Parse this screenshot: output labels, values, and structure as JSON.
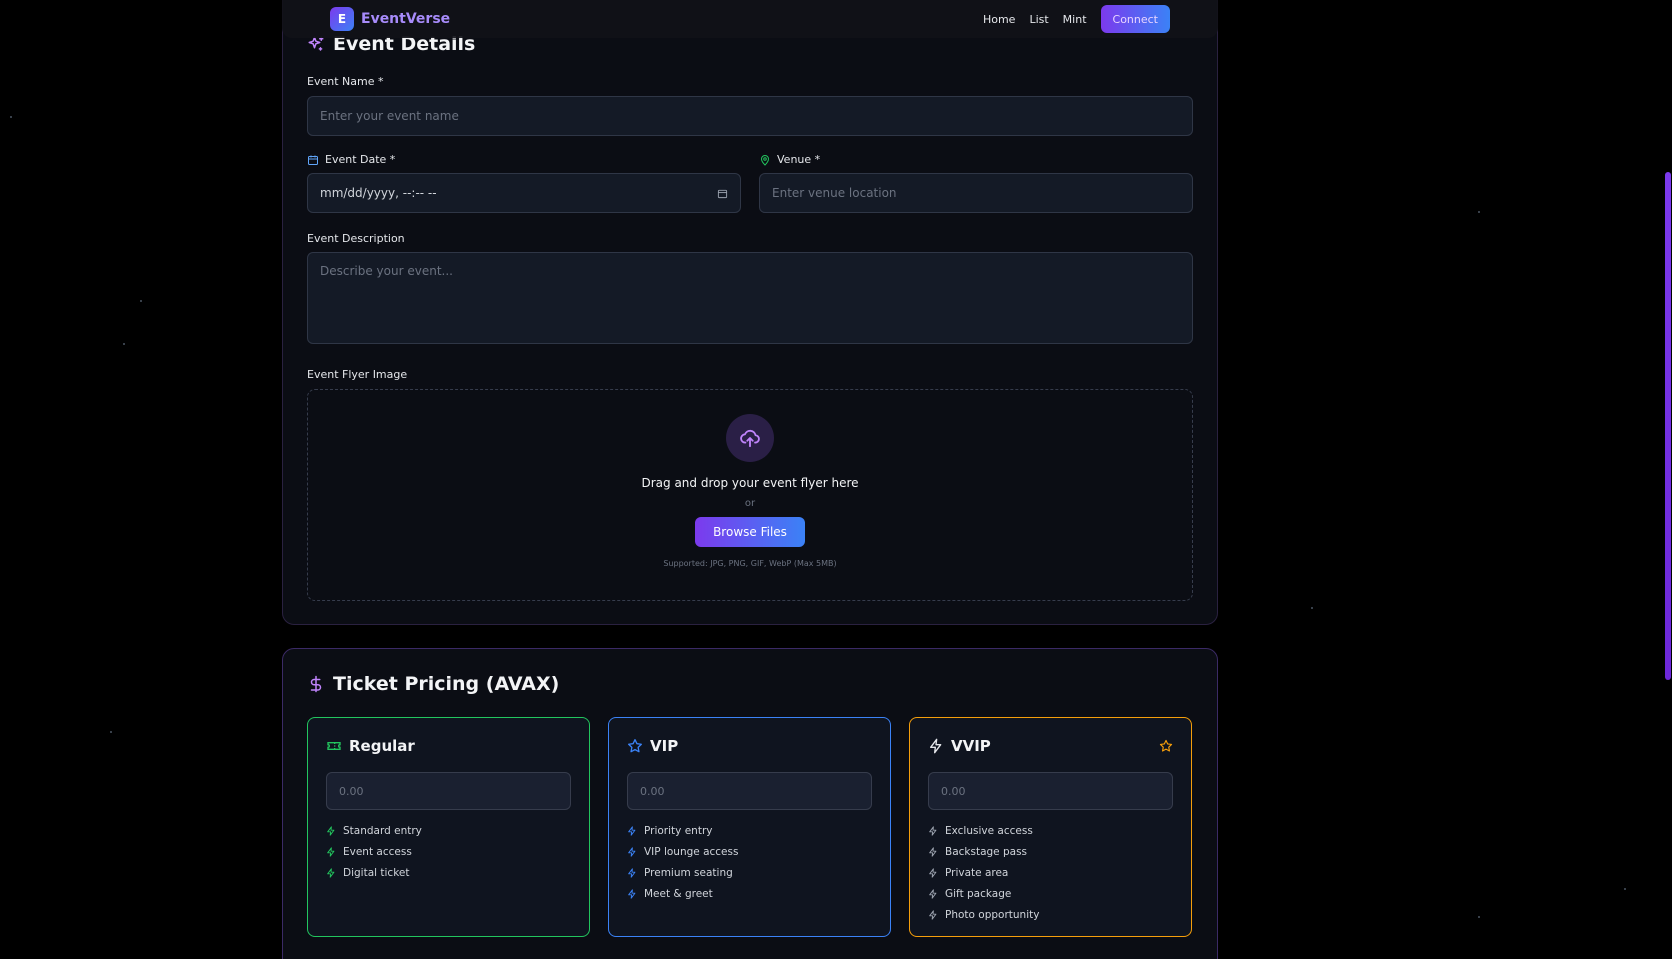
{
  "header": {
    "logo_letter": "E",
    "brand": "EventVerse",
    "nav": [
      "Home",
      "List",
      "Mint"
    ],
    "connect_label": "Connect"
  },
  "details": {
    "title": "Event Details",
    "event_name_label": "Event Name *",
    "event_name_placeholder": "Enter your event name",
    "event_date_label": "Event Date *",
    "event_date_value": "mm/dd/yyyy, --:-- --",
    "venue_label": "Venue *",
    "venue_placeholder": "Enter venue location",
    "description_label": "Event Description",
    "description_placeholder": "Describe your event...",
    "flyer_label": "Event Flyer Image",
    "dropzone": {
      "title": "Drag and drop your event flyer here",
      "or": "or",
      "browse_label": "Browse Files",
      "note": "Supported: JPG, PNG, GIF, WebP (Max 5MB)"
    }
  },
  "pricing": {
    "title": "Ticket Pricing (AVAX)",
    "tiers": [
      {
        "name": "Regular",
        "price_placeholder": "0.00",
        "icon": "ticket-icon",
        "color": "#22c55e",
        "features": [
          "Standard entry",
          "Event access",
          "Digital ticket"
        ]
      },
      {
        "name": "VIP",
        "price_placeholder": "0.00",
        "icon": "star-icon",
        "color": "#3b82f6",
        "features": [
          "Priority entry",
          "VIP lounge access",
          "Premium seating",
          "Meet & greet"
        ]
      },
      {
        "name": "VVIP",
        "price_placeholder": "0.00",
        "icon": "zap-icon",
        "color": "#f59e0b",
        "features": [
          "Exclusive access",
          "Backstage pass",
          "Private area",
          "Gift package",
          "Photo opportunity"
        ]
      }
    ]
  },
  "colors": {
    "accent_purple": "#7c3aed",
    "accent_blue": "#3b82f6",
    "background": "#000000",
    "card": "#0b0d14"
  }
}
